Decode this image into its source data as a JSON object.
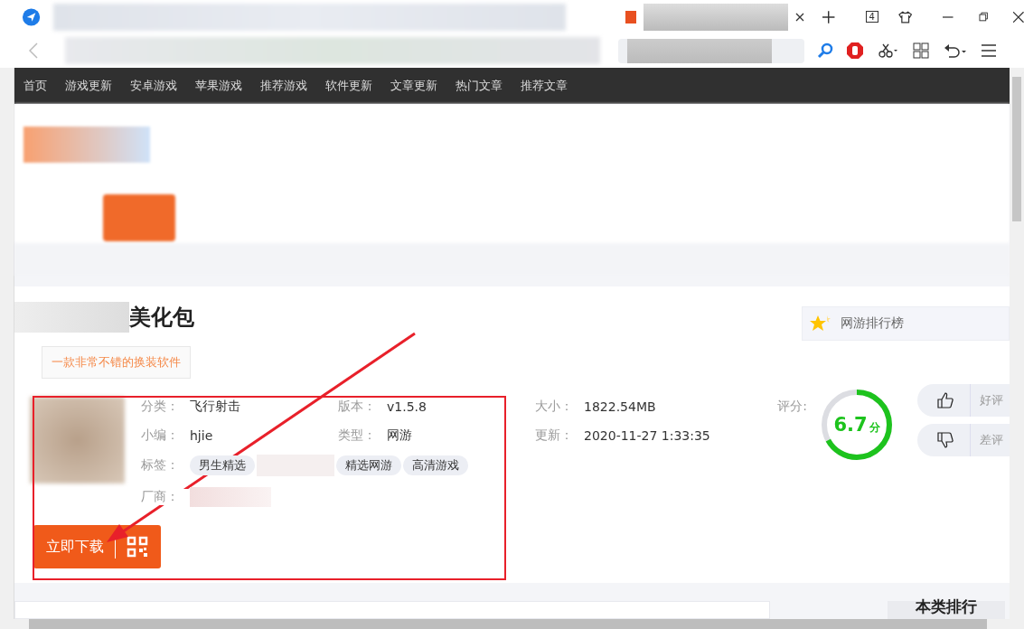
{
  "browser": {
    "tab_count": "4"
  },
  "nav": [
    "首页",
    "游戏更新",
    "安卓游戏",
    "苹果游戏",
    "推荐游戏",
    "软件更新",
    "文章更新",
    "热门文章",
    "推荐文章"
  ],
  "app": {
    "title": "美化包",
    "slogan": "一款非常不错的换装软件",
    "info": [
      {
        "label": "分类：",
        "value": "飞行射击"
      },
      {
        "label": "版本：",
        "value": "v1.5.8"
      },
      {
        "label": "小编：",
        "value": "hjie"
      },
      {
        "label": "类型：",
        "value": "网游"
      }
    ],
    "tags_label": "标签：",
    "tags": [
      "男生精选",
      "精选网游",
      "高清游戏"
    ],
    "maker_label": "厂商：",
    "download": "立即下载",
    "meta": [
      {
        "label": "大小：",
        "value": "1822.54MB"
      },
      {
        "label": "更新：",
        "value": "2020-11-27 1:33:35"
      }
    ]
  },
  "rating": {
    "label": "评分:",
    "score": "6.7",
    "unit": "分",
    "level": 0.67,
    "votes": [
      "好评",
      "差评"
    ]
  },
  "ranking_link": "网游排行榜",
  "section_title": "本类排行"
}
